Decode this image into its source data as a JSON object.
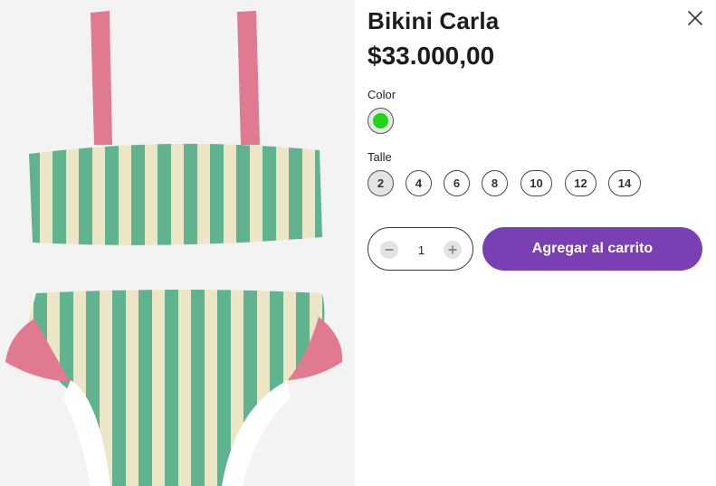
{
  "product": {
    "title": "Bikini Carla",
    "price": "$33.000,00",
    "image_alt": "Bikini de rayas verdes y crema con tiras rosadas"
  },
  "options": {
    "color_label": "Color",
    "color_selected": "#22d31a",
    "size_label": "Talle",
    "sizes": [
      "2",
      "4",
      "6",
      "8",
      "10",
      "12",
      "14"
    ],
    "size_selected": "2"
  },
  "cart": {
    "quantity": "1",
    "add_label": "Agregar al carrito",
    "accent_color": "#7b3fb4"
  },
  "icons": {
    "close": "close-icon",
    "minus": "minus-icon",
    "plus": "plus-icon"
  }
}
